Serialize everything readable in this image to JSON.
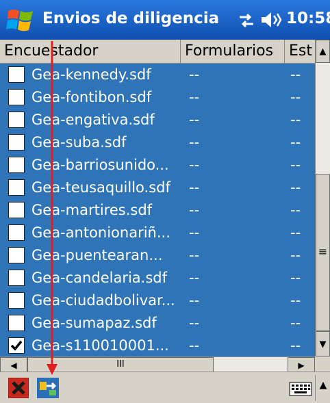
{
  "titlebar": {
    "app_title": "Envios de diligencia",
    "clock": "10:58",
    "start_icon": "windows-start-icon",
    "connectivity_icon": "connectivity-icon",
    "volume_icon": "volume-icon"
  },
  "table": {
    "columns": [
      "Encuestador",
      "Formularios",
      "Est"
    ],
    "rows": [
      {
        "name": "Gea-kennedy.sdf",
        "formularios": "--",
        "estado": "--",
        "checked": false
      },
      {
        "name": "Gea-fontibon.sdf",
        "formularios": "--",
        "estado": "--",
        "checked": false
      },
      {
        "name": "Gea-engativa.sdf",
        "formularios": "--",
        "estado": "--",
        "checked": false
      },
      {
        "name": "Gea-suba.sdf",
        "formularios": "--",
        "estado": "--",
        "checked": false
      },
      {
        "name": "Gea-barriosunido...",
        "formularios": "--",
        "estado": "--",
        "checked": false
      },
      {
        "name": "Gea-teusaquillo.sdf",
        "formularios": "--",
        "estado": "--",
        "checked": false
      },
      {
        "name": "Gea-martires.sdf",
        "formularios": "--",
        "estado": "--",
        "checked": false
      },
      {
        "name": "Gea-antonionariñ...",
        "formularios": "--",
        "estado": "--",
        "checked": false
      },
      {
        "name": "Gea-puentearan...",
        "formularios": "--",
        "estado": "--",
        "checked": false
      },
      {
        "name": "Gea-candelaria.sdf",
        "formularios": "--",
        "estado": "--",
        "checked": false
      },
      {
        "name": "Gea-ciudadbolivar...",
        "formularios": "--",
        "estado": "--",
        "checked": false
      },
      {
        "name": "Gea-sumapaz.sdf",
        "formularios": "--",
        "estado": "--",
        "checked": false
      },
      {
        "name": "Gea-s110010001...",
        "formularios": "--",
        "estado": "--",
        "checked": true
      }
    ]
  },
  "scrollbars": {
    "up_arrow": "▲",
    "down_arrow": "▼",
    "left_arrow": "◀",
    "right_arrow": "▶",
    "grip_v": "≡",
    "grip_h": "III"
  },
  "bottombar": {
    "close_icon": "close-icon",
    "send_icon": "send-icon",
    "keyboard_icon": "keyboard-icon",
    "sip_arrow": "▲"
  },
  "colors": {
    "titlebar": "#1c63c8",
    "row_bg": "#2f74b6",
    "annotation_arrow": "#e02020"
  }
}
